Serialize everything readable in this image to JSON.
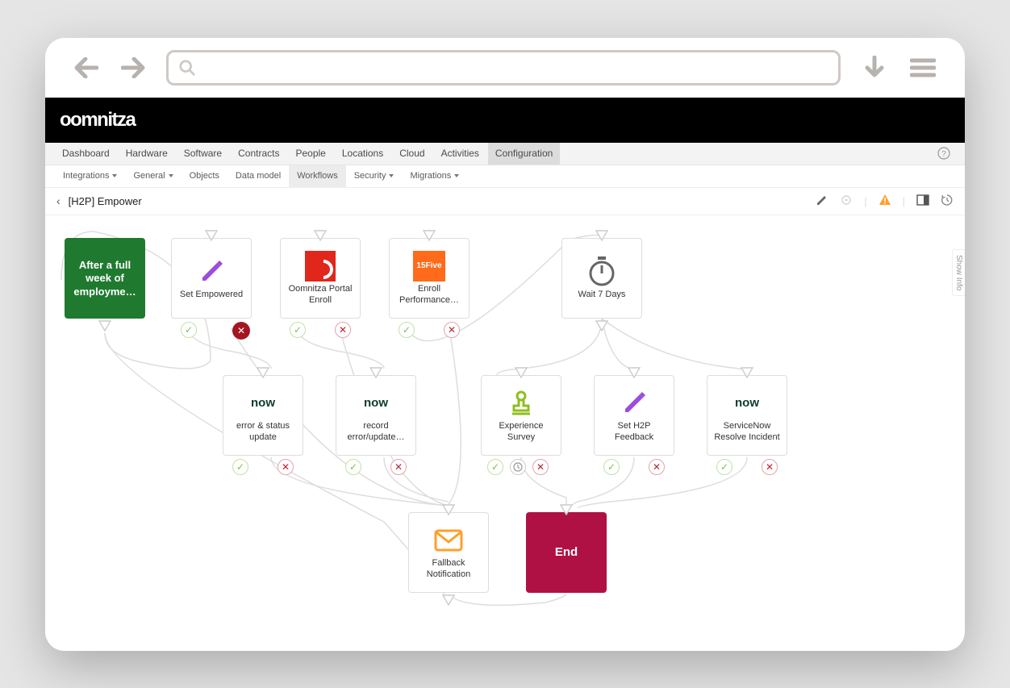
{
  "browser": {
    "search_placeholder": ""
  },
  "brand": "oomnitza",
  "black_bar_right": "",
  "main_tabs": [
    "Dashboard",
    "Hardware",
    "Software",
    "Contracts",
    "People",
    "Locations",
    "Cloud",
    "Activities",
    "Configuration"
  ],
  "main_tab_active": 8,
  "sub_tabs": [
    {
      "label": "Integrations",
      "caret": true
    },
    {
      "label": "General",
      "caret": true
    },
    {
      "label": "Objects",
      "caret": false
    },
    {
      "label": "Data model",
      "caret": false
    },
    {
      "label": "Workflows",
      "caret": false
    },
    {
      "label": "Security",
      "caret": true
    },
    {
      "label": "Migrations",
      "caret": true
    }
  ],
  "sub_tab_active": 4,
  "breadcrumb": "[H2P] Empower",
  "side_tab": "Show Info",
  "nodes": {
    "start": {
      "label": "After a full week of employme…"
    },
    "setemp": {
      "label": "Set Empowered"
    },
    "portal": {
      "label": "Oomnitza Portal Enroll"
    },
    "enroll15": {
      "label": "Enroll Performance…",
      "badge": "15Five"
    },
    "wait": {
      "label": "Wait 7 Days"
    },
    "errstat": {
      "label": "error & status update",
      "badge": "now"
    },
    "recerr": {
      "label": "record error/update…",
      "badge": "now"
    },
    "survey": {
      "label": "Experience Survey"
    },
    "seth2p": {
      "label": "Set H2P Feedback"
    },
    "snow": {
      "label": "ServiceNow Resolve Incident",
      "badge": "now"
    },
    "fallback": {
      "label": "Fallback Notification"
    },
    "end": {
      "label": "End"
    }
  }
}
